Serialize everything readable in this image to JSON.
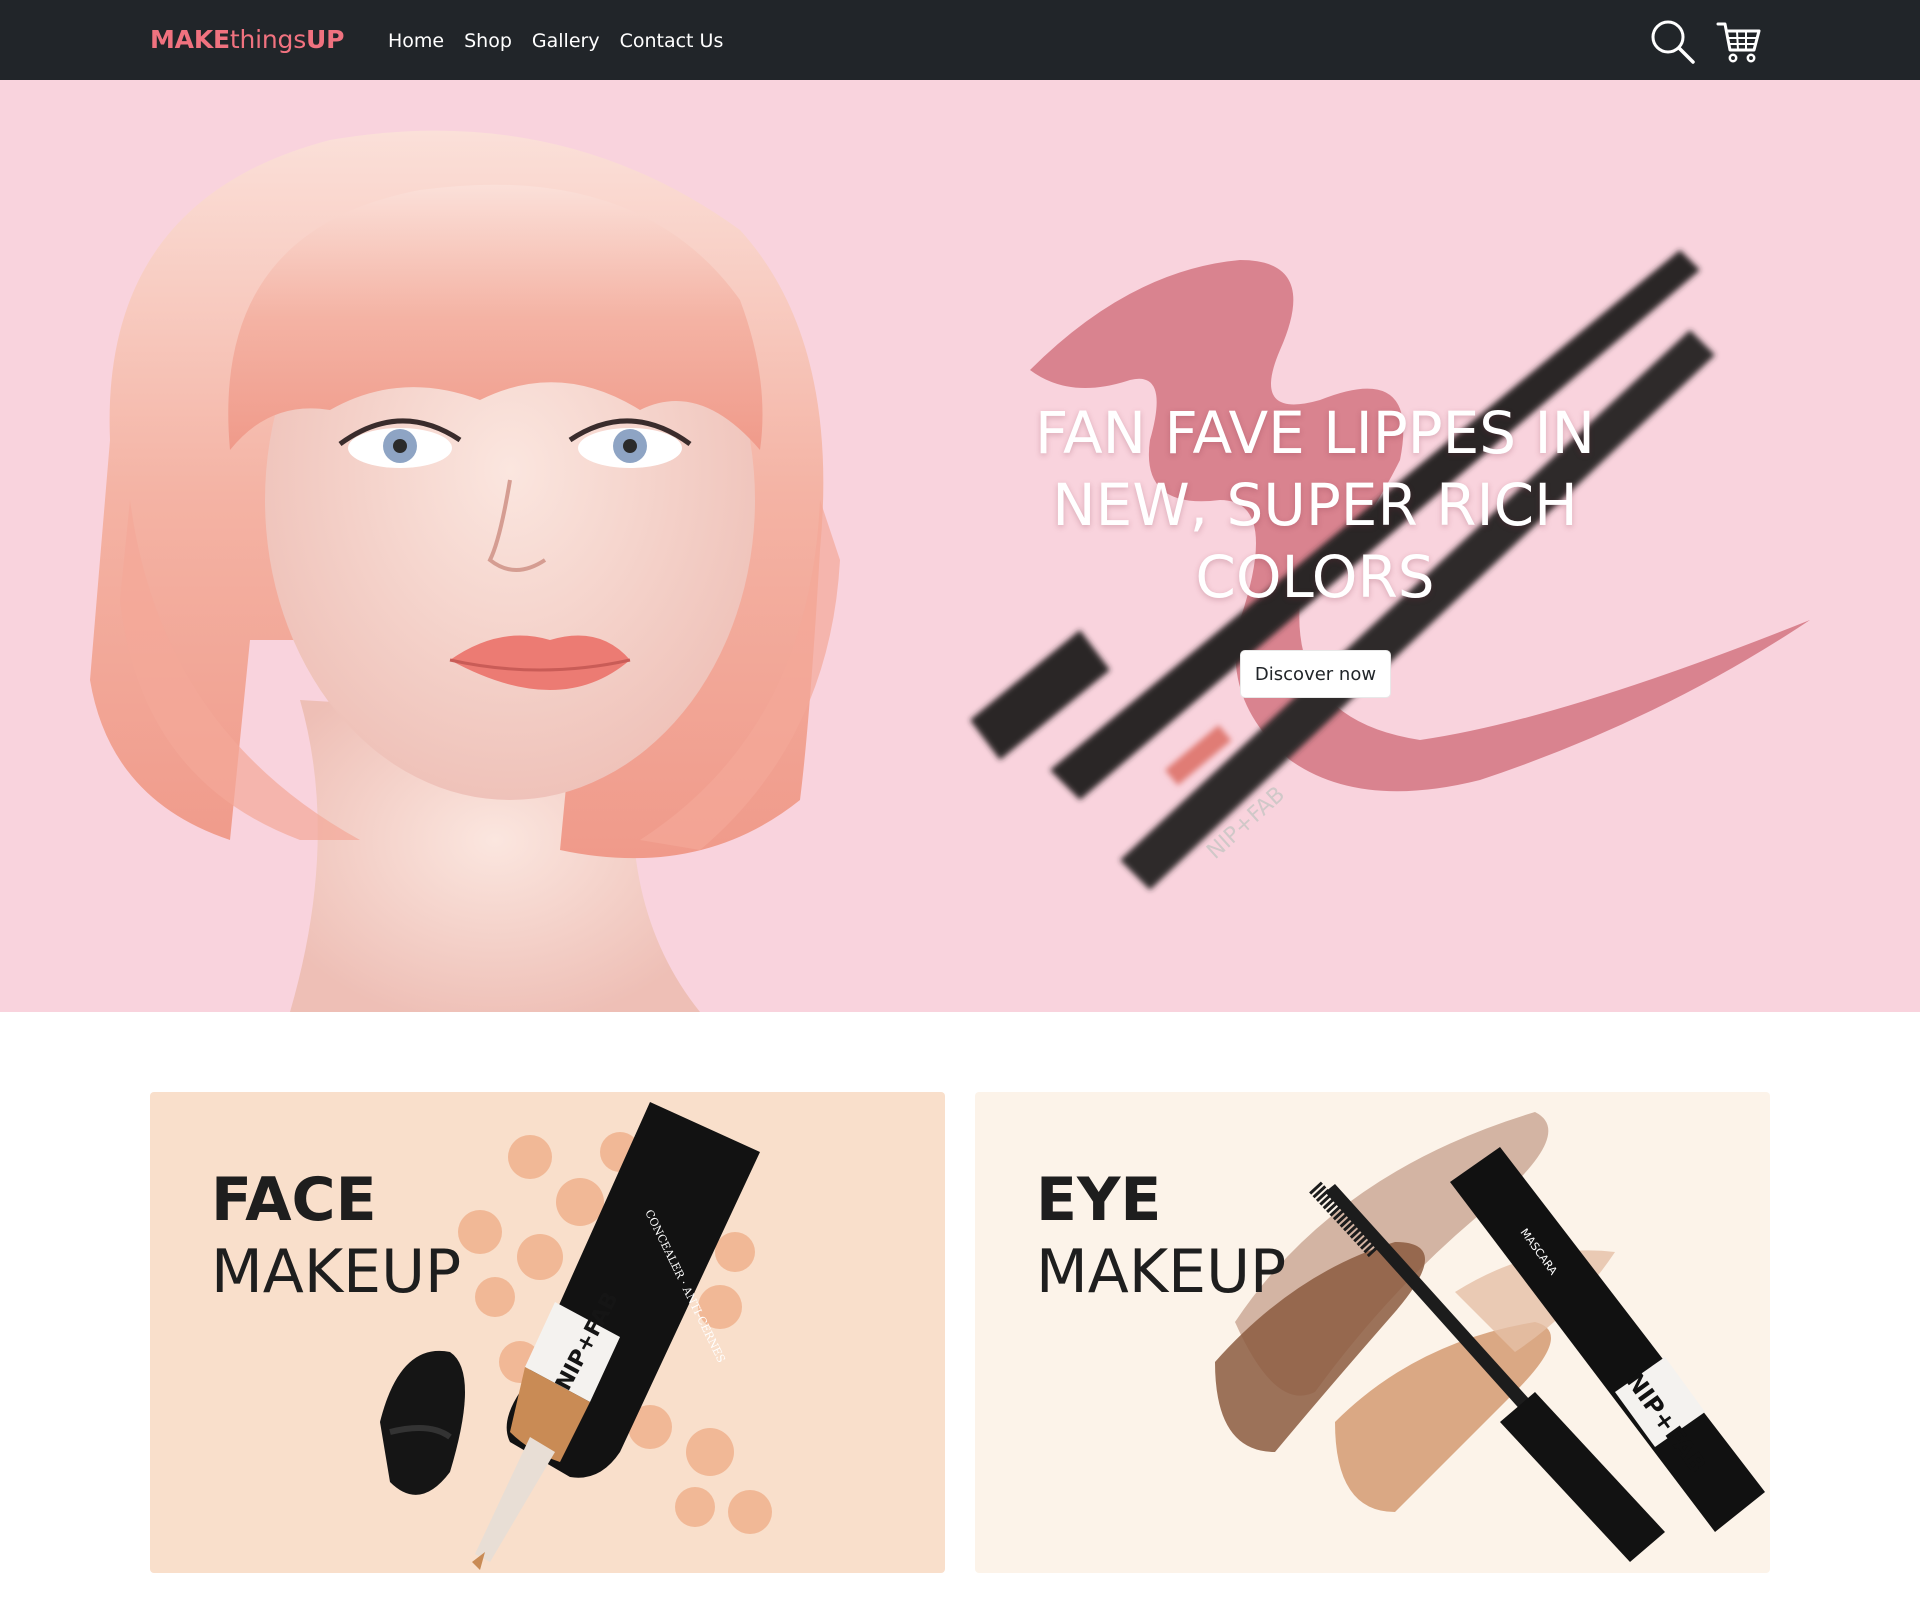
{
  "nav": {
    "brand": {
      "part1": "MAKE",
      "part2": "things",
      "part3": "UP"
    },
    "links": [
      "Home",
      "Shop",
      "Gallery",
      "Contact Us"
    ],
    "icons": [
      "search-icon",
      "cart-icon"
    ]
  },
  "hero": {
    "heading": "FAN FAVE LIPPES IN NEW, SUPER RICH COLORS",
    "button": "Discover now",
    "product_label": "NIP+FAB"
  },
  "categories": [
    {
      "title_bold": "FACE",
      "title_light": "MAKEUP",
      "product_label": "NIP+FAB",
      "product_sublabel": "CONCEALER · ANTI-CERNES"
    },
    {
      "title_bold": "EYE",
      "title_light": "MAKEUP",
      "product_label": "NIP+FAB",
      "product_sublabel": "MASCARA"
    }
  ],
  "colors": {
    "navbar": "#212529",
    "brand": "#f0727f",
    "hero_bg": "#f9d3dd",
    "face_card_bg": "#f9dfcb",
    "eye_card_bg": "#fcf3e9"
  }
}
